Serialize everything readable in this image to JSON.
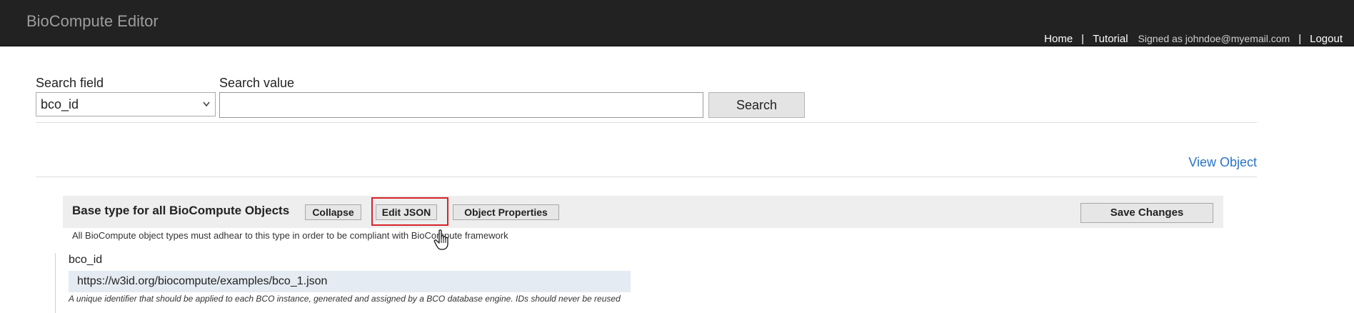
{
  "navbar": {
    "brand": "BioCompute Editor",
    "home": "Home",
    "separator": "|",
    "tutorial": "Tutorial",
    "signed_as": "Signed as johndoe@myemail.com",
    "logout": "Logout"
  },
  "search": {
    "field_label": "Search field",
    "field_selected": "bco_id",
    "value_label": "Search value",
    "value": "",
    "button": "Search"
  },
  "view_object": "View Object",
  "panel": {
    "title": "Base type for all BioCompute Objects",
    "collapse": "Collapse",
    "edit_json": "Edit JSON",
    "object_properties": "Object Properties",
    "save_changes": "Save Changes",
    "description": "All BioCompute object types must adhear to this type in order to be compliant with BioCompute framework"
  },
  "field": {
    "label": "bco_id",
    "value": "https://w3id.org/biocompute/examples/bco_1.json",
    "hint": "A unique identifier that should be applied to each BCO instance, generated and assigned by a BCO database engine. IDs should never be reused"
  },
  "colors": {
    "navbar_bg": "#222222",
    "link": "#2a73c7",
    "highlight": "#d8232a",
    "field_bg": "#e4ebf2"
  },
  "icons": {
    "select": "chevron-down-icon",
    "cursor": "hand-pointer-icon"
  }
}
